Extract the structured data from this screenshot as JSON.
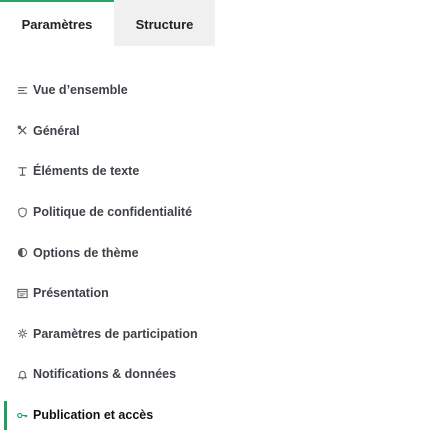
{
  "tabs": [
    {
      "label": "Paramètres",
      "active": true
    },
    {
      "label": "Structure",
      "active": false
    }
  ],
  "accent_color": "#1f9e5f",
  "menu": {
    "items": [
      {
        "label": "Vue d’ensemble",
        "icon": "list-icon"
      },
      {
        "label": "Général",
        "icon": "tools-icon"
      },
      {
        "label": "Éléments de texte",
        "icon": "text-icon"
      },
      {
        "label": "Politique de confidentialité",
        "icon": "shield-icon"
      },
      {
        "label": "Options de thème",
        "icon": "contrast-icon"
      },
      {
        "label": "Présentation",
        "icon": "window-icon"
      },
      {
        "label": "Paramètres de participation",
        "icon": "gear-icon"
      },
      {
        "label": "Notifications & données",
        "icon": "bell-icon"
      },
      {
        "label": "Publication et accès",
        "icon": "key-icon",
        "selected": true
      }
    ]
  }
}
